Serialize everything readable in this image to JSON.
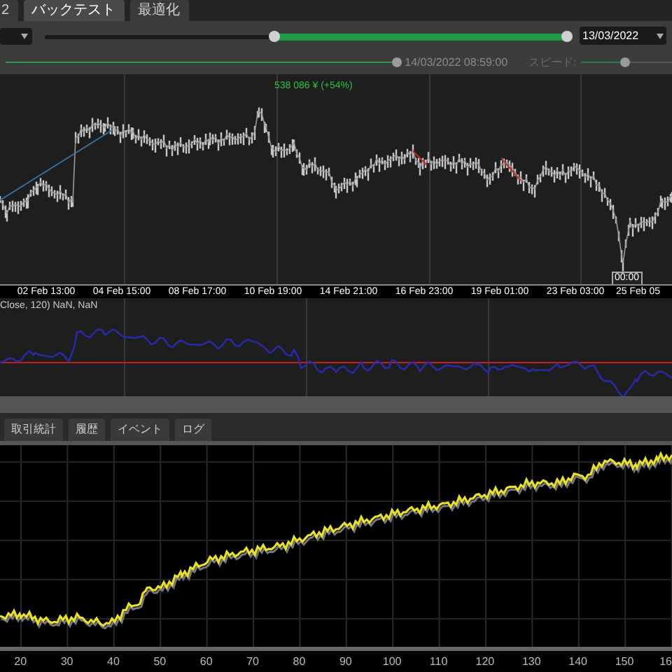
{
  "tabs": [
    {
      "label": "2",
      "selected": false
    },
    {
      "label": "バックテスト",
      "selected": true
    },
    {
      "label": "最適化",
      "selected": false
    }
  ],
  "end_date": "13/03/2022",
  "playback": {
    "level": 1,
    "time": "14/03/2022 08:59:00"
  },
  "speed": {
    "label": "スピード:",
    "level": 0.5
  },
  "price_label": "538 086 ¥ (+54%)",
  "time_axis": [
    "02 Feb 13:00",
    "04 Feb 15:00",
    "08 Feb 17:00",
    "10 Feb 19:00",
    "14 Feb 21:00",
    "16 Feb 23:00",
    "19 Feb 01:00",
    "23 Feb 03:00",
    "25 Feb 05"
  ],
  "cursor_time": "00:00",
  "indicator_label": "Close, 120) NaN, NaN",
  "bottom_tabs": [
    {
      "label": "取引統計",
      "selected": false
    },
    {
      "label": "履歴",
      "selected": false
    },
    {
      "label": "イベント",
      "selected": false
    },
    {
      "label": "ログ",
      "selected": false
    }
  ],
  "equity_axis": [
    "20",
    "30",
    "40",
    "50",
    "60",
    "70",
    "80",
    "90",
    "100",
    "110",
    "120",
    "130",
    "140",
    "150",
    "16"
  ]
}
